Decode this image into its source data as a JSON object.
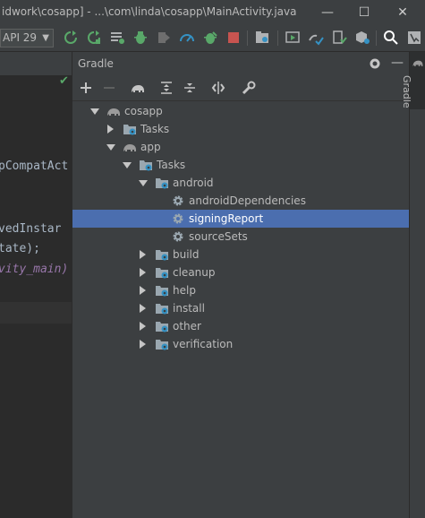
{
  "window": {
    "title": "idwork\\cosapp] - ...\\com\\linda\\cosapp\\MainActivity.java",
    "minimize": "—",
    "maximize": "☐",
    "close": "✕"
  },
  "toolbar": {
    "device_select": "API 29",
    "icons": [
      "apply-changes-icon",
      "apply-code-changes-icon",
      "logcat-icon",
      "debug-icon",
      "profile-icon",
      "attach-debugger-icon",
      "debug-bug-icon",
      "stop-icon",
      "sdk-manager-icon",
      "avd-manager-icon",
      "sync-project-icon",
      "device-manager-icon",
      "package-icon",
      "search-icon",
      "layout-inspector-icon"
    ]
  },
  "editor": {
    "lines": [
      "pCompatAct",
      "vedInstar",
      "tate);",
      "vity_main)"
    ]
  },
  "gradle": {
    "title": "Gradle",
    "toolbar_icons": [
      "add-icon",
      "remove-icon",
      "elephant-icon",
      "expand-all-icon",
      "collapse-all-icon",
      "toggle-offline-icon",
      "wrench-icon"
    ],
    "tree": [
      {
        "label": "cosapp",
        "depth": 0,
        "state": "expanded",
        "icon": "gradle-elephant-icon",
        "selected": false
      },
      {
        "label": "Tasks",
        "depth": 1,
        "state": "collapsed",
        "icon": "task-folder-icon",
        "selected": false
      },
      {
        "label": "app",
        "depth": 1,
        "state": "expanded",
        "icon": "gradle-elephant-icon",
        "selected": false
      },
      {
        "label": "Tasks",
        "depth": 2,
        "state": "expanded",
        "icon": "task-folder-icon",
        "selected": false
      },
      {
        "label": "android",
        "depth": 3,
        "state": "expanded",
        "icon": "task-folder-icon",
        "selected": false
      },
      {
        "label": "androidDependencies",
        "depth": 4,
        "state": "leaf",
        "icon": "gear-icon",
        "selected": false
      },
      {
        "label": "signingReport",
        "depth": 4,
        "state": "leaf",
        "icon": "gear-icon",
        "selected": true
      },
      {
        "label": "sourceSets",
        "depth": 4,
        "state": "leaf",
        "icon": "gear-icon",
        "selected": false
      },
      {
        "label": "build",
        "depth": 3,
        "state": "collapsed",
        "icon": "task-folder-icon",
        "selected": false
      },
      {
        "label": "cleanup",
        "depth": 3,
        "state": "collapsed",
        "icon": "task-folder-icon",
        "selected": false
      },
      {
        "label": "help",
        "depth": 3,
        "state": "collapsed",
        "icon": "task-folder-icon",
        "selected": false
      },
      {
        "label": "install",
        "depth": 3,
        "state": "collapsed",
        "icon": "task-folder-icon",
        "selected": false
      },
      {
        "label": "other",
        "depth": 3,
        "state": "collapsed",
        "icon": "task-folder-icon",
        "selected": false
      },
      {
        "label": "verification",
        "depth": 3,
        "state": "collapsed",
        "icon": "task-folder-icon",
        "selected": false
      }
    ]
  },
  "side_strip": {
    "tab_label": "Gradle"
  }
}
